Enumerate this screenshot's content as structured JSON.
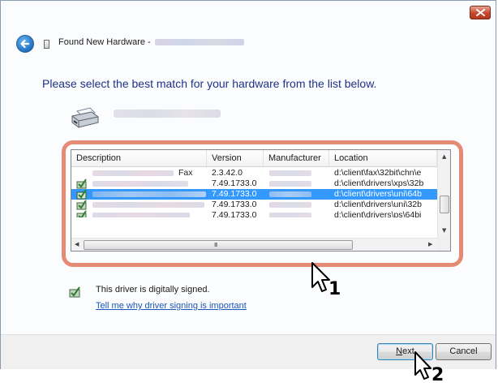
{
  "window": {
    "title": "Found New Hardware -",
    "close_label": "close"
  },
  "instruction": "Please select the best match for your hardware from the list below.",
  "driver_list": {
    "columns": [
      "Description",
      "Version",
      "Manufacturer",
      "Location"
    ],
    "rows": [
      {
        "description_suffix": "Fax",
        "version": "2.3.42.0",
        "location": "d:\\client\\fax\\32bit\\chn\\e",
        "selected": false,
        "signed": false
      },
      {
        "description_suffix": "",
        "version": "7.49.1733.0",
        "location": "d:\\client\\drivers\\xps\\32b",
        "selected": false,
        "signed": true
      },
      {
        "description_suffix": "",
        "version": "7.49.1733.0",
        "location": "d:\\client\\drivers\\uni\\64b",
        "selected": true,
        "signed": true
      },
      {
        "description_suffix": "",
        "version": "7.49.1733.0",
        "location": "d:\\client\\drivers\\uni\\32b",
        "selected": false,
        "signed": true
      },
      {
        "description_suffix": "",
        "version": "7.49.1733.0",
        "location": "d:\\client\\drivers\\ps\\64bi",
        "selected": false,
        "signed": true
      }
    ],
    "hscroll_grip": "III"
  },
  "signed_text": "This driver is digitally signed.",
  "signing_link": "Tell me why driver signing is important",
  "buttons": {
    "next": "Next",
    "next_accesskey": "N",
    "cancel": "Cancel"
  },
  "callouts": [
    "1",
    "2"
  ],
  "colors": {
    "selection": "#3399ff",
    "instruction": "#1e3287",
    "highlight": "#e58b75",
    "link": "#1a56b8"
  },
  "icons": [
    "close-icon",
    "back-arrow-icon",
    "hardware-icon",
    "printer-icon",
    "signed-driver-icon",
    "mouse-pointer-icon"
  ]
}
